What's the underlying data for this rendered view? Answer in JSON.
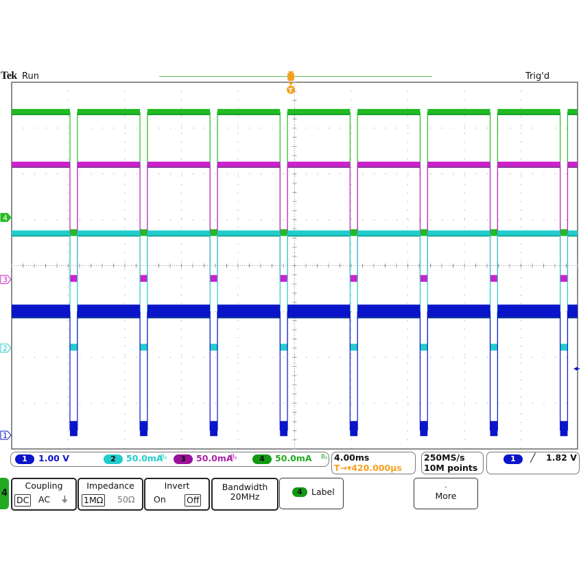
{
  "header": {
    "brand": "Tek",
    "acq_state": "Run",
    "trigger_status": "Trig'd"
  },
  "colors": {
    "ch1": "#0a14c8",
    "ch2": "#22cccc",
    "ch3": "#cc22cc",
    "ch4": "#22bb22",
    "trigger": "#f5a020",
    "grid": "#888888"
  },
  "graticule": {
    "h_divisions": 10,
    "v_divisions": 8
  },
  "channel_markers": [
    {
      "channel": "4",
      "label": "4"
    },
    {
      "channel": "3",
      "label": "3"
    },
    {
      "channel": "2",
      "label": "2"
    },
    {
      "channel": "1",
      "label": "1"
    }
  ],
  "trigger_marker": "T",
  "waveform": {
    "pulse_count": 8,
    "description": "Periodic pulse train; all four channels step simultaneously during ~0.53 div pulses repeating every ~1.25 div",
    "period_div": 1.25,
    "pulse_width_div": 0.135,
    "ch4_levels_div": {
      "high": 3.35,
      "low": 0.7
    },
    "ch3_levels_div": {
      "high": 2.2,
      "low": -0.3
    },
    "ch2_levels_div": {
      "high": 0.7,
      "low": -1.8
    },
    "ch1_levels_div": {
      "high": -1.0,
      "low": -3.6
    }
  },
  "readouts": {
    "ch1": {
      "num": "1",
      "scale": "1.00 V"
    },
    "ch2": {
      "num": "2",
      "scale": "50.0mA",
      "bw_icon": "bandwidth-limit-icon"
    },
    "ch3": {
      "num": "3",
      "scale": "50.0mA",
      "bw_icon": "bandwidth-limit-icon"
    },
    "ch4": {
      "num": "4",
      "scale": "50.0mA",
      "bw_icon": "bandwidth-limit-icon"
    },
    "timebase": "4.00ms",
    "trigger_pos": "T→▾420.000µs",
    "sample_rate": "250MS/s",
    "record_length": "10M points",
    "trigger_source": "1",
    "trigger_slope": "rising-edge-icon",
    "trigger_level": "1.82 V"
  },
  "menu": {
    "channel_tab": "4",
    "coupling": {
      "title": "Coupling",
      "options": [
        "DC",
        "AC",
        "⏚"
      ],
      "selected": "DC"
    },
    "impedance": {
      "title": "Impedance",
      "options": [
        "1MΩ",
        "50Ω"
      ],
      "selected": "1MΩ"
    },
    "invert": {
      "title": "Invert",
      "options": [
        "On",
        "Off"
      ],
      "selected": "Off"
    },
    "bandwidth": {
      "title": "Bandwidth",
      "value": "20MHz"
    },
    "label": {
      "badge": "4",
      "text": "Label"
    },
    "more": {
      "text": "More"
    }
  }
}
